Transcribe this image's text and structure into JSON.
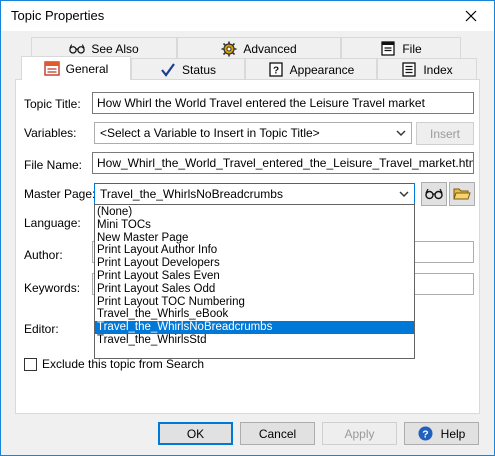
{
  "window": {
    "title": "Topic Properties"
  },
  "tabs": {
    "row_back": [
      {
        "label": "See Also",
        "icon": "glasses-icon"
      },
      {
        "label": "Advanced",
        "icon": "gear-icon"
      },
      {
        "label": "File",
        "icon": "file-icon"
      }
    ],
    "row_front": [
      {
        "label": "General",
        "icon": "general-icon",
        "active": true
      },
      {
        "label": "Status",
        "icon": "checkmark-icon"
      },
      {
        "label": "Appearance",
        "icon": "help-box-icon"
      },
      {
        "label": "Index",
        "icon": "index-icon"
      }
    ]
  },
  "form": {
    "topic_title_label": "Topic Title:",
    "topic_title_value": "How Whirl the World Travel entered the Leisure Travel market",
    "variables_label": "Variables:",
    "variables_value": "<Select a Variable to Insert in Topic Title>",
    "insert_label": "Insert",
    "file_name_label": "File Name:",
    "file_name_value": "How_Whirl_the_World_Travel_entered_the_Leisure_Travel_market.htm",
    "master_page_label": "Master Page:",
    "master_page_value": "Travel_the_WhirlsNoBreadcrumbs",
    "language_label": "Language:",
    "author_label": "Author:",
    "keywords_label": "Keywords:",
    "editor_label": "Editor:",
    "exclude_label": "Exclude this topic from Search"
  },
  "master_page_options": [
    "(None)",
    "Mini TOCs",
    "New Master Page",
    "Print Layout Author Info",
    "Print Layout Developers",
    "Print Layout Sales Even",
    "Print Layout Sales Odd",
    "Print Layout TOC Numbering",
    "Travel_the_Whirls_eBook",
    "Travel_the_WhirlsNoBreadcrumbs",
    "Travel_the_WhirlsStd"
  ],
  "selected_option_index": 9,
  "buttons": {
    "ok": "OK",
    "cancel": "Cancel",
    "apply": "Apply",
    "help": "Help"
  },
  "colors": {
    "accent": "#0078d7",
    "window_border": "#1883d7"
  }
}
